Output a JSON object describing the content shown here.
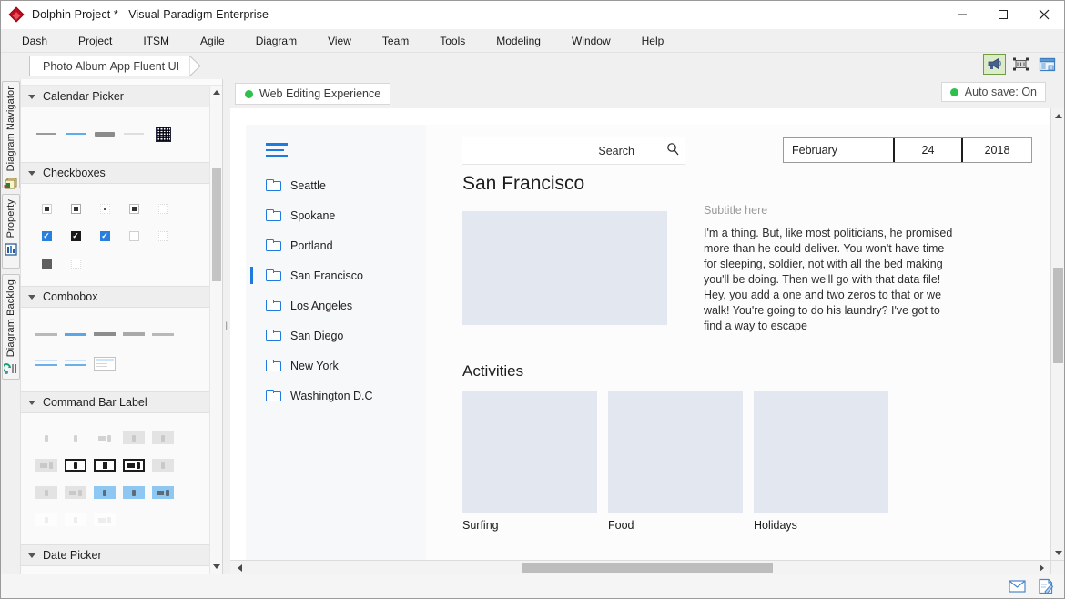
{
  "window": {
    "title": "Dolphin Project * - Visual Paradigm Enterprise",
    "app_icon": "diamond-logo-icon",
    "minimize": "minimize-button",
    "maximize": "maximize-button",
    "close": "close-button"
  },
  "menubar": {
    "items": [
      {
        "label": "Dash"
      },
      {
        "label": "Project"
      },
      {
        "label": "ITSM"
      },
      {
        "label": "Agile"
      },
      {
        "label": "Diagram"
      },
      {
        "label": "View"
      },
      {
        "label": "Team"
      },
      {
        "label": "Tools"
      },
      {
        "label": "Modeling"
      },
      {
        "label": "Window"
      },
      {
        "label": "Help"
      }
    ]
  },
  "tabstrip": {
    "diagram_tab": "Photo Album App Fluent UI",
    "buttons": [
      {
        "name": "announcement-icon",
        "active": true
      },
      {
        "name": "fit-to-screen-icon",
        "active": false
      },
      {
        "name": "open-specification-icon",
        "active": false
      }
    ]
  },
  "vdock": {
    "tabs": [
      {
        "label": "Diagram Navigator",
        "icon": "diagram-navigator-icon"
      },
      {
        "label": "Property",
        "icon": "property-icon"
      },
      {
        "label": "Diagram Backlog",
        "icon": "diagram-backlog-icon"
      }
    ]
  },
  "palette": {
    "groups": [
      {
        "title": "Calendar Picker",
        "id": "calendar-picker"
      },
      {
        "title": "Checkboxes",
        "id": "checkboxes"
      },
      {
        "title": "Combobox",
        "id": "combobox"
      },
      {
        "title": "Command Bar Label",
        "id": "command-bar-label"
      },
      {
        "title": "Date Picker",
        "id": "date-picker"
      }
    ]
  },
  "canvas": {
    "web_tag": "Web Editing Experience",
    "auto_save": "Auto save: On"
  },
  "mock": {
    "nav": {
      "menu_icon": "hamburger-menu-icon",
      "items": [
        {
          "label": "Seattle",
          "selected": false
        },
        {
          "label": "Spokane",
          "selected": false
        },
        {
          "label": "Portland",
          "selected": false
        },
        {
          "label": "San Francisco",
          "selected": true
        },
        {
          "label": "Los Angeles",
          "selected": false
        },
        {
          "label": "San Diego",
          "selected": false
        },
        {
          "label": "New York",
          "selected": false
        },
        {
          "label": "Washington D.C",
          "selected": false
        }
      ]
    },
    "search": {
      "label": "Search",
      "icon": "search-icon"
    },
    "date_picker": {
      "month": "February",
      "day": "24",
      "year": "2018"
    },
    "city_title": "San Francisco",
    "subtitle": "Subtitle here",
    "body_text": "I'm a thing. But, like most politicians, he promised more than he could deliver. You won't have time for sleeping, soldier, not with all the bed making you'll be doing. Then we'll go with that data file! Hey, you add a one and two zeros to that or we walk! You're going to do his laundry? I've got to find a way to escape",
    "activities_title": "Activities",
    "cards": [
      {
        "caption": "Surfing"
      },
      {
        "caption": "Food"
      },
      {
        "caption": "Holidays"
      }
    ]
  },
  "statusbar": {
    "icons": [
      {
        "name": "message-icon"
      },
      {
        "name": "annotation-icon"
      }
    ]
  },
  "colors": {
    "accent_blue": "#1f7ae0",
    "green_status": "#2ec04a",
    "placeholder_fill": "#e3e7f0",
    "titlebar_bg": "#ffffff",
    "chrome_bg": "#f0f0f0"
  }
}
